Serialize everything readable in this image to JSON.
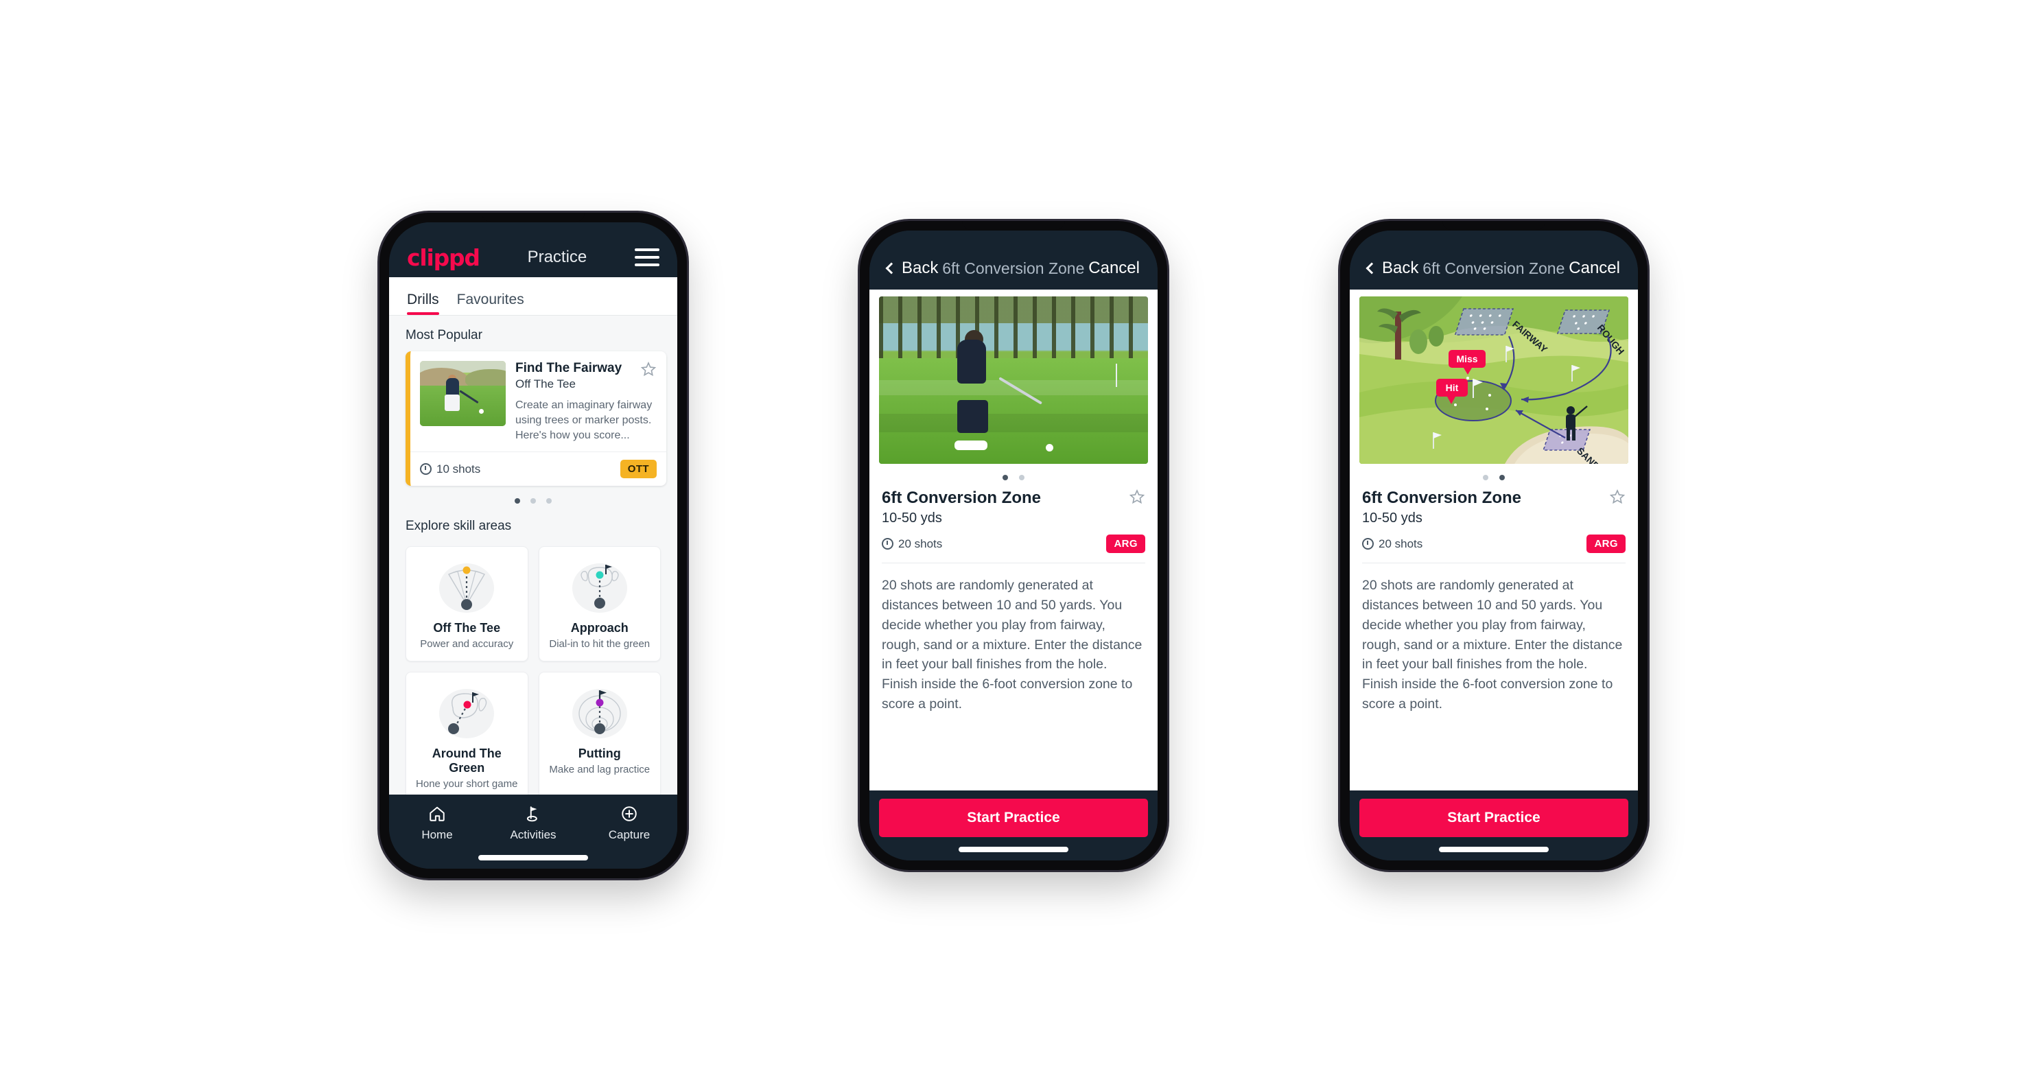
{
  "brand": {
    "name": "clippd",
    "accent_pink": "#F50A4D",
    "dark_navy": "#16232F",
    "amber": "#F5B324",
    "teal": "#2DD4BF",
    "purple": "#A020C0",
    "page_background": "#FFFFFF"
  },
  "phone1": {
    "appbar": {
      "logo": "clippd",
      "title": "Practice",
      "menu_icon": "hamburger-menu-icon"
    },
    "tabs": [
      {
        "label": "Drills",
        "active": true
      },
      {
        "label": "Favourites",
        "active": false
      }
    ],
    "most_popular": {
      "section_title": "Most Popular",
      "card": {
        "accent_color": "#F5B324",
        "title": "Find The Fairway",
        "subtitle": "Off The Tee",
        "description": "Create an imaginary fairway using trees or marker posts. Here's how you score...",
        "shots": "10 shots",
        "badge": "OTT",
        "favourite_icon": "star-outline-icon",
        "shots_icon": "clock-icon",
        "thumbnail": "golfer-teeing-off-photo"
      },
      "next_card_accent": "#2DD4BF",
      "carousel_dots": {
        "count": 3,
        "active_index": 0
      }
    },
    "explore": {
      "section_title": "Explore skill areas",
      "skills": [
        {
          "name": "Off The Tee",
          "desc": "Power and accuracy",
          "icon": "tee-fan-icon",
          "dot_color": "#F5B324"
        },
        {
          "name": "Approach",
          "desc": "Dial-in to hit the green",
          "icon": "green-approach-icon",
          "dot_color": "#2DD4BF"
        },
        {
          "name": "Around The Green",
          "desc": "Hone your short game",
          "icon": "chip-around-green-icon",
          "dot_color": "#F50A4D"
        },
        {
          "name": "Putting",
          "desc": "Make and lag practice",
          "icon": "putting-rings-icon",
          "dot_color": "#A020C0"
        }
      ]
    },
    "bottom_nav": [
      {
        "label": "Home",
        "icon": "home-icon",
        "active": false
      },
      {
        "label": "Activities",
        "icon": "golf-flag-icon",
        "active": true
      },
      {
        "label": "Capture",
        "icon": "plus-circle-icon",
        "active": false
      }
    ]
  },
  "phone2": {
    "navbar": {
      "back": "Back",
      "title": "6ft Conversion Zone",
      "cancel": "Cancel",
      "back_icon": "chevron-left-icon"
    },
    "hero": {
      "type": "photo",
      "alt": "golfer-chipping-onto-green-photo"
    },
    "dots": {
      "count": 2,
      "active_index": 0
    },
    "detail": {
      "title": "6ft Conversion Zone",
      "subtitle": "10-50 yds",
      "shots": "20 shots",
      "badge": "ARG",
      "favourite_icon": "star-outline-icon",
      "shots_icon": "clock-icon",
      "description": "20 shots are randomly generated at distances between 10 and 50 yards. You decide whether you play from fairway, rough, sand or a mixture. Enter the distance in feet your ball finishes from the hole. Finish inside the 6-foot conversion zone to score a point."
    },
    "cta": "Start Practice"
  },
  "phone3": {
    "navbar": {
      "back": "Back",
      "title": "6ft Conversion Zone",
      "cancel": "Cancel",
      "back_icon": "chevron-left-icon"
    },
    "hero": {
      "type": "illustration",
      "alt": "golf-hole-lie-diagram",
      "zone_labels": [
        "FAIRWAY",
        "ROUGH",
        "SAND"
      ],
      "callouts": [
        "Miss",
        "Hit"
      ],
      "callout_color": "#F50A4D"
    },
    "dots": {
      "count": 2,
      "active_index": 1
    },
    "detail": {
      "title": "6ft Conversion Zone",
      "subtitle": "10-50 yds",
      "shots": "20 shots",
      "badge": "ARG",
      "favourite_icon": "star-outline-icon",
      "shots_icon": "clock-icon",
      "description": "20 shots are randomly generated at distances between 10 and 50 yards. You decide whether you play from fairway, rough, sand or a mixture. Enter the distance in feet your ball finishes from the hole. Finish inside the 6-foot conversion zone to score a point."
    },
    "cta": "Start Practice"
  }
}
